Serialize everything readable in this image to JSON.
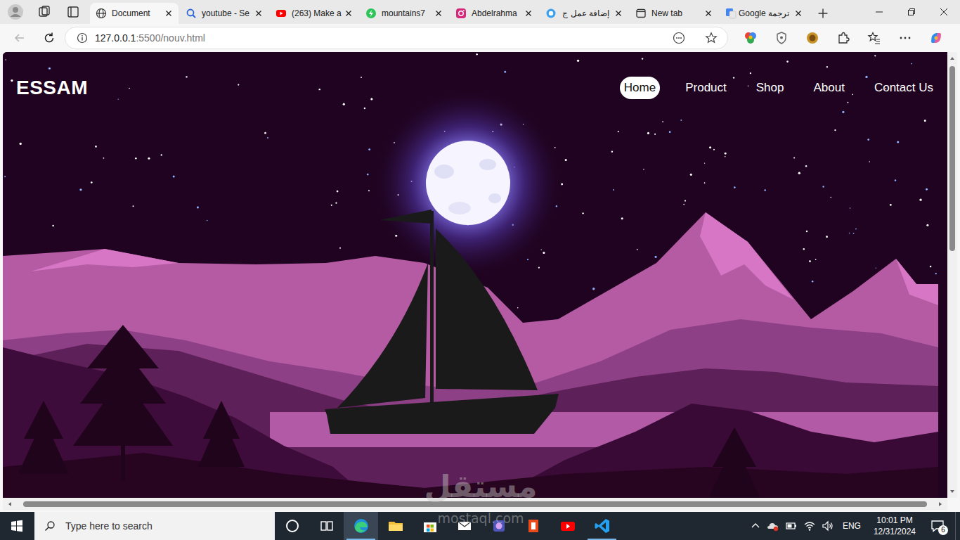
{
  "browser": {
    "tabs": [
      {
        "label": "Document",
        "kind": "globe",
        "selected": true
      },
      {
        "label": "youtube - Se",
        "kind": "search",
        "selected": false
      },
      {
        "label": "(263) Make a",
        "kind": "youtube",
        "selected": false
      },
      {
        "label": "mountains7",
        "kind": "bolt",
        "selected": false
      },
      {
        "label": "Abdelrahma",
        "kind": "instagram",
        "selected": false
      },
      {
        "label": "إضافة عمل ج",
        "kind": "circle",
        "selected": false
      },
      {
        "label": "New tab",
        "kind": "newtab",
        "selected": false
      },
      {
        "label": "ترجمة Google",
        "kind": "translate",
        "selected": false
      }
    ],
    "address": {
      "host": "127.0.0.1",
      "path": ":5500/nouv.html"
    }
  },
  "page": {
    "logo": "ESSAM",
    "nav": [
      {
        "label": "Home",
        "selected": true
      },
      {
        "label": "Product",
        "selected": false
      },
      {
        "label": "Shop",
        "selected": false
      },
      {
        "label": "About",
        "selected": false
      },
      {
        "label": "Contact Us",
        "selected": false
      }
    ]
  },
  "watermark": {
    "name": "مستقل",
    "site": "mostaql.com"
  },
  "taskbar": {
    "search": {
      "placeholder": "Type here to search"
    },
    "apps": [
      {
        "kind": "cortana",
        "active": false,
        "running": false
      },
      {
        "kind": "taskview",
        "active": false,
        "running": false
      },
      {
        "kind": "edge",
        "active": true,
        "running": true
      },
      {
        "kind": "explorer",
        "active": false,
        "running": false
      },
      {
        "kind": "store",
        "active": false,
        "running": false
      },
      {
        "kind": "mail",
        "active": false,
        "running": false
      },
      {
        "kind": "app",
        "active": false,
        "running": false
      },
      {
        "kind": "office",
        "active": false,
        "running": false
      },
      {
        "kind": "youtube",
        "active": false,
        "running": false
      },
      {
        "kind": "vscode",
        "active": false,
        "running": true
      }
    ],
    "language": "ENG",
    "time": "10:01 PM",
    "date": "12/31/2024",
    "notifications": "6"
  }
}
